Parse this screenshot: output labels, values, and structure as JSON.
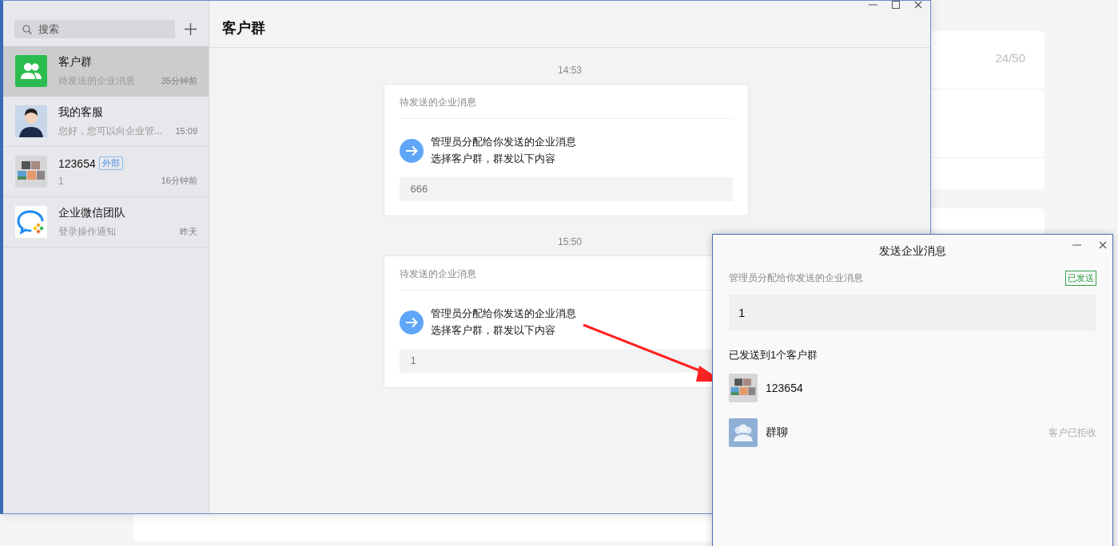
{
  "background": {
    "counter": "24/50"
  },
  "window": {
    "title": "客户群"
  },
  "search": {
    "placeholder": "搜索"
  },
  "conversations": [
    {
      "name": "客户群",
      "preview": "待发送的企业消息",
      "time": "35分钟前",
      "kind": "group",
      "selected": true
    },
    {
      "name": "我的客服",
      "preview": "您好，您可以向企业管...",
      "time": "15:09",
      "selected": false
    },
    {
      "name": "123654",
      "badge": "外部",
      "preview": "1",
      "time": "16分钟前",
      "kind": "collage",
      "selected": false
    },
    {
      "name": "企业微信团队",
      "preview": "登录操作通知",
      "time": "昨天",
      "kind": "logo",
      "selected": false
    }
  ],
  "messages": [
    {
      "time": "14:53",
      "card_title": "待发送的企业消息",
      "headline": "管理员分配给你发送的企业消息",
      "subline": "选择客户群，群发以下内容",
      "content": "666"
    },
    {
      "time": "15:50",
      "card_title": "待发送的企业消息",
      "headline": "管理员分配给你发送的企业消息",
      "subline": "选择客户群，群发以下内容",
      "content": "1"
    }
  ],
  "dialog": {
    "title": "发送企业消息",
    "subtitle": "管理员分配给你发送的企业消息",
    "status": "已发送",
    "content": "1",
    "sent_heading": "已发送到1个客户群",
    "groups": [
      {
        "name": "123654",
        "kind": "collage"
      },
      {
        "name": "群聊",
        "kind": "placeholder",
        "note": "客户已拒收"
      }
    ]
  }
}
